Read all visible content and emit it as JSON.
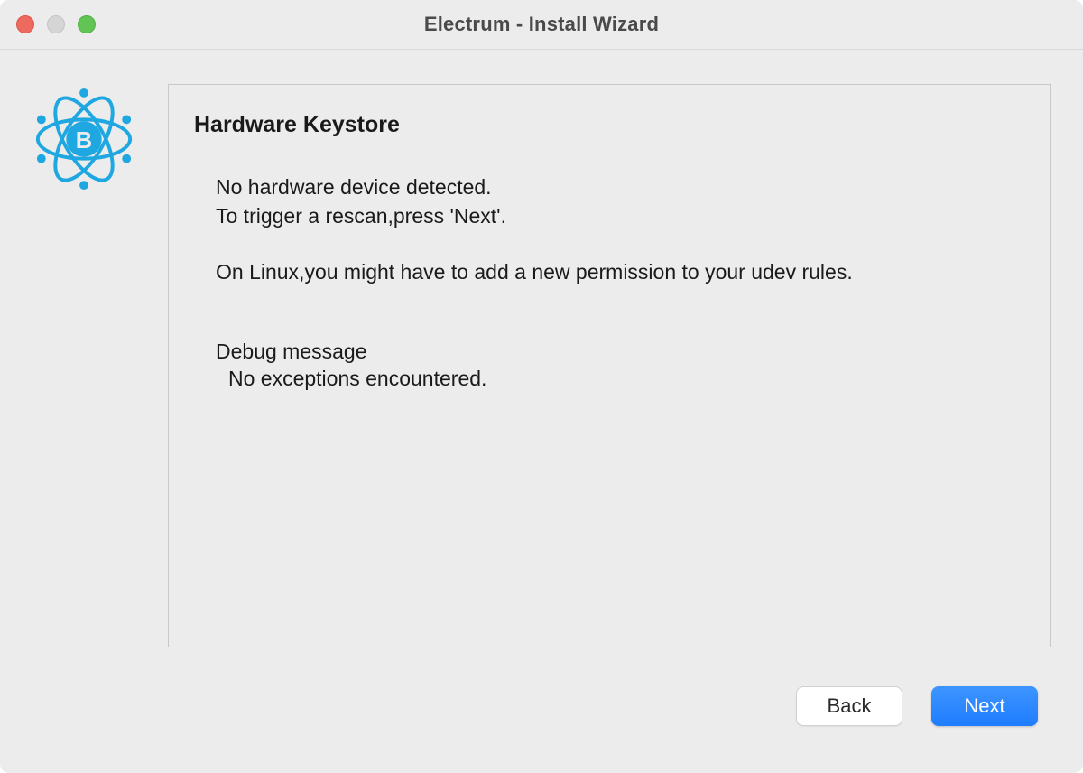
{
  "window": {
    "title": "Electrum  -  Install Wizard"
  },
  "main": {
    "heading": "Hardware Keystore",
    "line1": "No hardware device detected.",
    "line2": "To trigger a rescan,press 'Next'.",
    "line3": "On Linux,you might have to add a new permission to your udev rules.",
    "debug_label": "Debug message",
    "debug_text": "No exceptions encountered."
  },
  "buttons": {
    "back": "Back",
    "next": "Next"
  },
  "colors": {
    "accent": "#1f7dff",
    "logo": "#1ea7e1"
  }
}
